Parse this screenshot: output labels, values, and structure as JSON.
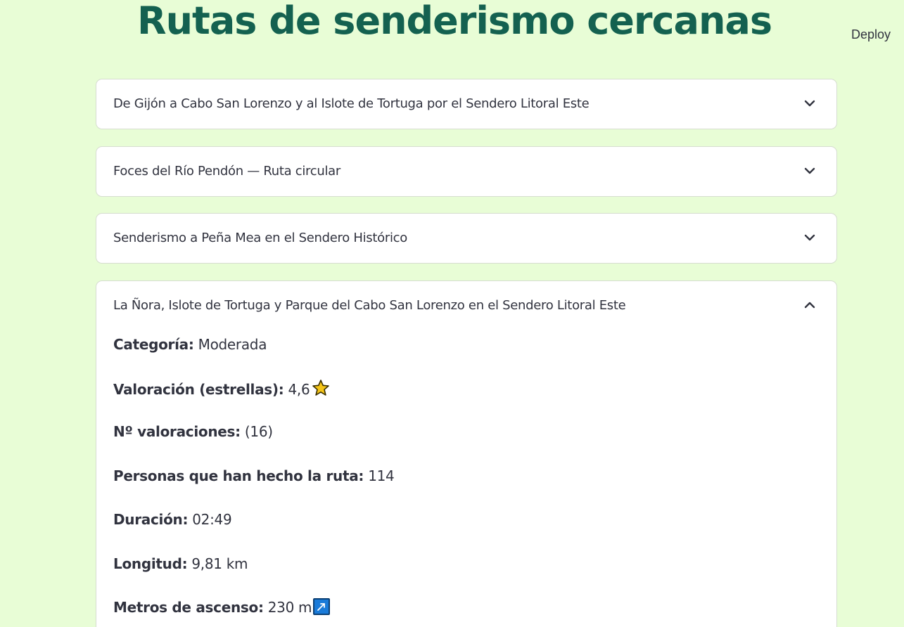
{
  "header": {
    "deploy_label": "Deploy",
    "title": "Rutas de senderismo cercanas"
  },
  "routes": [
    {
      "title": "De Gijón a Cabo San Lorenzo y al Islote de Tortuga por el Sendero Litoral Este",
      "expanded": false
    },
    {
      "title": "Foces del Río Pendón — Ruta circular",
      "expanded": false
    },
    {
      "title": "Senderismo a Peña Mea en el Sendero Histórico",
      "expanded": false
    },
    {
      "title": "La Ñora, Islote de Tortuga y Parque del Cabo San Lorenzo en el Sendero Litoral Este",
      "expanded": true,
      "details": {
        "categoria_label": "Categoría:",
        "categoria_value": "Moderada",
        "valoracion_label": "Valoración (estrellas):",
        "valoracion_value": "4,6",
        "valoracion_icon": "star-icon",
        "num_valoraciones_label": "Nº valoraciones:",
        "num_valoraciones_value": "(16)",
        "personas_label": "Personas que han hecho la ruta:",
        "personas_value": "114",
        "duracion_label": "Duración:",
        "duracion_value": "02:49",
        "longitud_label": "Longitud:",
        "longitud_value": "9,81 km",
        "ascenso_label": "Metros de ascenso:",
        "ascenso_value": "230 m",
        "ascenso_icon": "arrow-up-right-icon"
      }
    }
  ],
  "colors": {
    "background": "#e8fdd6",
    "title": "#146150",
    "card": "#ffffff",
    "text": "#31333f",
    "star": "#f5c518",
    "arrow_box": "#1a7bd9"
  }
}
